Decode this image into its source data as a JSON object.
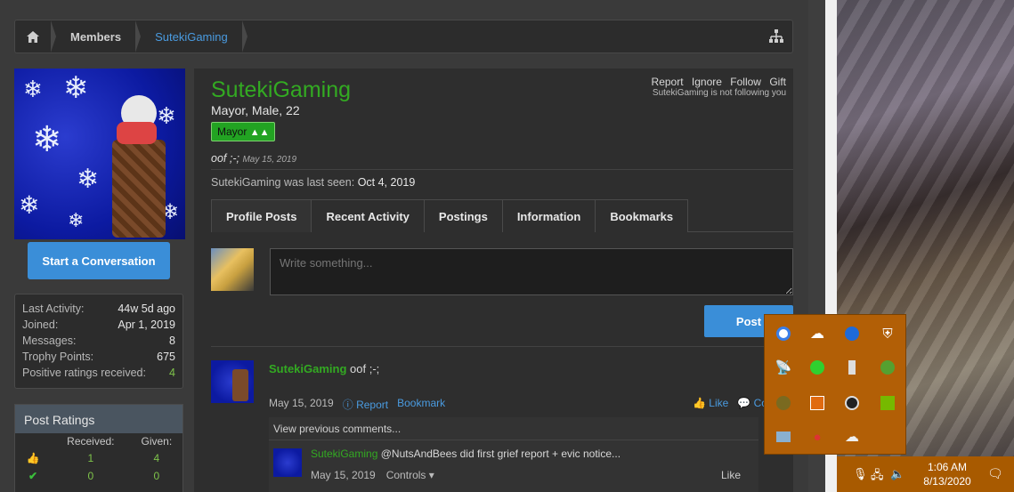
{
  "breadcrumb": {
    "items": [
      {
        "label": "Members"
      },
      {
        "label": "SutekiGaming"
      }
    ]
  },
  "sidebar": {
    "start_conversation": "Start a Conversation",
    "stats": [
      {
        "label": "Last Activity:",
        "value": "44w 5d ago"
      },
      {
        "label": "Joined:",
        "value": "Apr 1, 2019"
      },
      {
        "label": "Messages:",
        "value": "8"
      },
      {
        "label": "Trophy Points:",
        "value": "675"
      },
      {
        "label": "Positive ratings received:",
        "value": "4"
      }
    ],
    "ratings": {
      "title": "Post Ratings",
      "received_label": "Received:",
      "given_label": "Given:",
      "rows": [
        {
          "icon": "thumbs-up-icon",
          "received": "1",
          "given": "4"
        },
        {
          "icon": "check-icon",
          "received": "0",
          "given": "0"
        }
      ]
    }
  },
  "profile": {
    "username": "SutekiGaming",
    "title_line": "Mayor, Male, 22",
    "badge": "Mayor",
    "status_text": "oof ;-;",
    "status_date": "May 15, 2019",
    "last_seen_label": "SutekiGaming was last seen:",
    "last_seen_value": "Oct 4, 2019",
    "actions": [
      "Report",
      "Ignore",
      "Follow",
      "Gift"
    ],
    "not_following": "SutekiGaming is not following you"
  },
  "tabs": [
    "Profile Posts",
    "Recent Activity",
    "Postings",
    "Information",
    "Bookmarks"
  ],
  "composer": {
    "placeholder": "Write something...",
    "post_label": "Post"
  },
  "post": {
    "author": "SutekiGaming",
    "text": "oof ;-;",
    "date": "May 15, 2019",
    "report": "Report",
    "bookmark": "Bookmark",
    "like": "Like",
    "comment": "Con",
    "view_previous": "View previous comments...",
    "comment_item": {
      "author": "SutekiGaming",
      "text": "@NutsAndBees did first grief report + evic notice...",
      "date": "May 15, 2019",
      "controls": "Controls",
      "like": "Like"
    }
  },
  "taskbar": {
    "time": "1:06 AM",
    "date": "8/13/2020"
  },
  "tray": {
    "icons": [
      "chrome-icon",
      "cloud-upload-icon",
      "bluetooth-icon",
      "security-shield-icon",
      "satellite-icon",
      "cloud-green-icon",
      "usb-icon",
      "game-icon",
      "steam-mini-icon",
      "fire-icon",
      "obs-icon",
      "nvidia-icon",
      "tool-icon",
      "microphone-icon",
      "onedrive-icon"
    ]
  }
}
